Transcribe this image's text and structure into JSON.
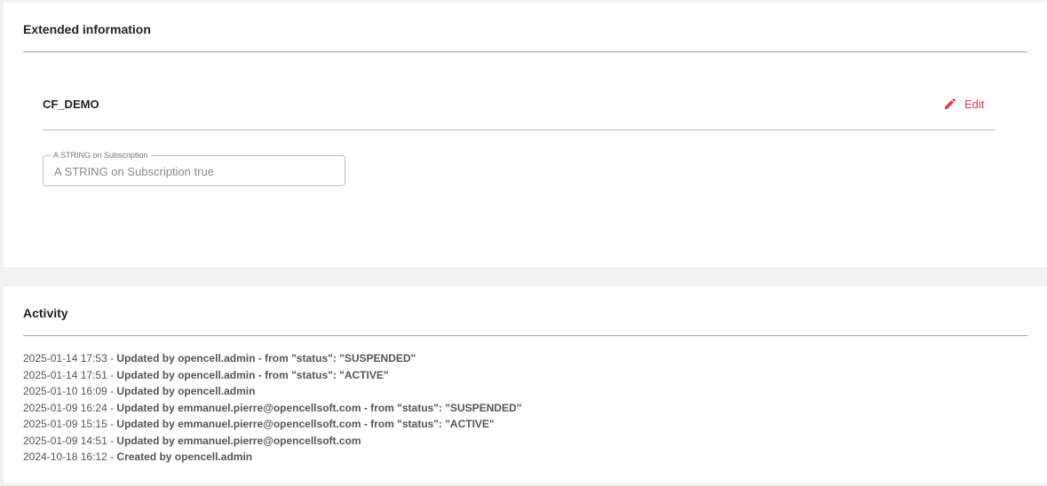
{
  "extended": {
    "title": "Extended information",
    "cf": {
      "name": "CF_DEMO",
      "edit_label": "Edit",
      "field_label": "A STRING on Subscription",
      "field_value": "A STRING on Subscription true"
    }
  },
  "activity": {
    "title": "Activity",
    "entries": [
      {
        "time": "2025-01-14 17:53",
        "desc": "Updated by opencell.admin - from \"status\": \"SUSPENDED\""
      },
      {
        "time": "2025-01-14 17:51",
        "desc": "Updated by opencell.admin - from \"status\": \"ACTIVE\""
      },
      {
        "time": "2025-01-10 16:09",
        "desc": "Updated by opencell.admin"
      },
      {
        "time": "2025-01-09 16:24",
        "desc": "Updated by emmanuel.pierre@opencellsoft.com - from \"status\": \"SUSPENDED\""
      },
      {
        "time": "2025-01-09 15:15",
        "desc": "Updated by emmanuel.pierre@opencellsoft.com - from \"status\": \"ACTIVE\""
      },
      {
        "time": "2025-01-09 14:51",
        "desc": "Updated by emmanuel.pierre@opencellsoft.com"
      },
      {
        "time": "2024-10-18 16:12",
        "desc": "Created by opencell.admin"
      }
    ],
    "separator": " - "
  },
  "colors": {
    "accent": "#e5374a",
    "background": "#f1f1f1",
    "card": "#ffffff"
  },
  "icons": {
    "edit": "pencil-icon"
  }
}
